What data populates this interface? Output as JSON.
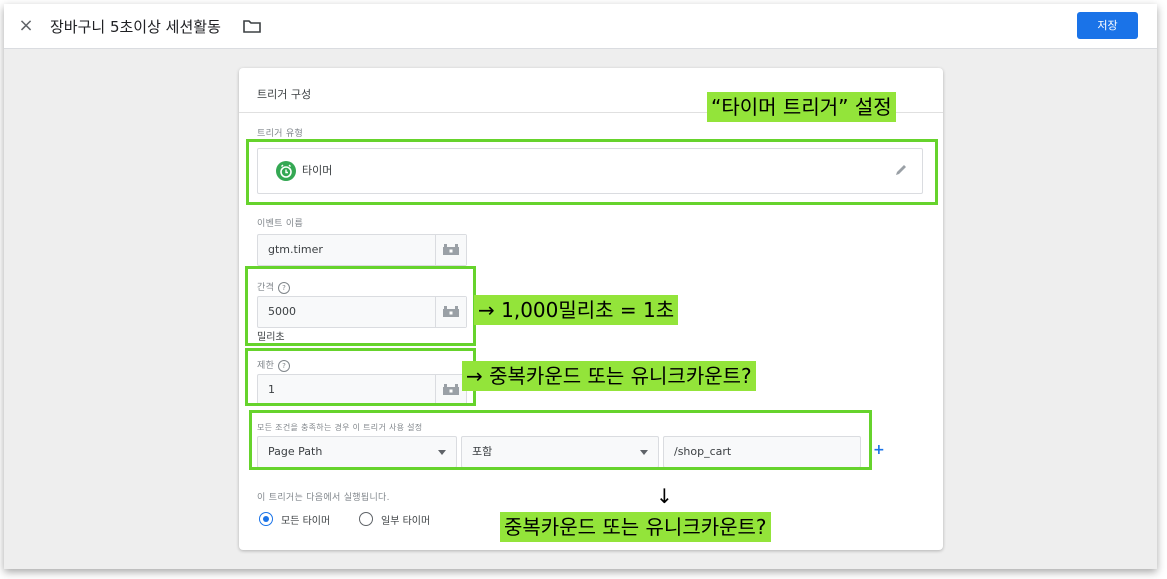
{
  "header": {
    "close_icon": "×",
    "title": "장바구니 5초이상 세션활동",
    "folder_icon": "folder-icon",
    "save_label": "저장"
  },
  "card": {
    "title": "트리거 구성",
    "trigger_type_label": "트리거 유형",
    "trigger_type_value": "타이머",
    "trigger_type_icon": "timer-icon",
    "event_name_label": "이벤트 이름",
    "event_name_value": "gtm.timer",
    "interval_label": "간격",
    "interval_value": "5000",
    "interval_unit": "밀리초",
    "limit_label": "제한",
    "limit_value": "1",
    "condition_label": "모든 조건을 충족하는 경우 이 트리거 사용 설정",
    "condition_variable": "Page Path",
    "condition_operator": "포함",
    "condition_value": "/shop_cart",
    "add_condition": "+",
    "fires_on_label": "이 트리거는 다음에서 실행됩니다.",
    "fires_on_options": [
      "모든 타이머",
      "일부 타이머"
    ],
    "fires_on_selected": "모든 타이머"
  },
  "annotations": {
    "trigger_type": "“타이머 트리거” 설정",
    "interval": "→  1,000밀리초 = 1초",
    "limit": "→ 중복카운드 또는 유니크카운트?",
    "condition_arrow": "↓",
    "condition": "중복카운드 또는 유니크카운트?"
  },
  "colors": {
    "highlight_border": "#66d32c",
    "highlight_fill": "#93e43a",
    "primary": "#1a73e8",
    "timer_icon": "#34a853"
  }
}
